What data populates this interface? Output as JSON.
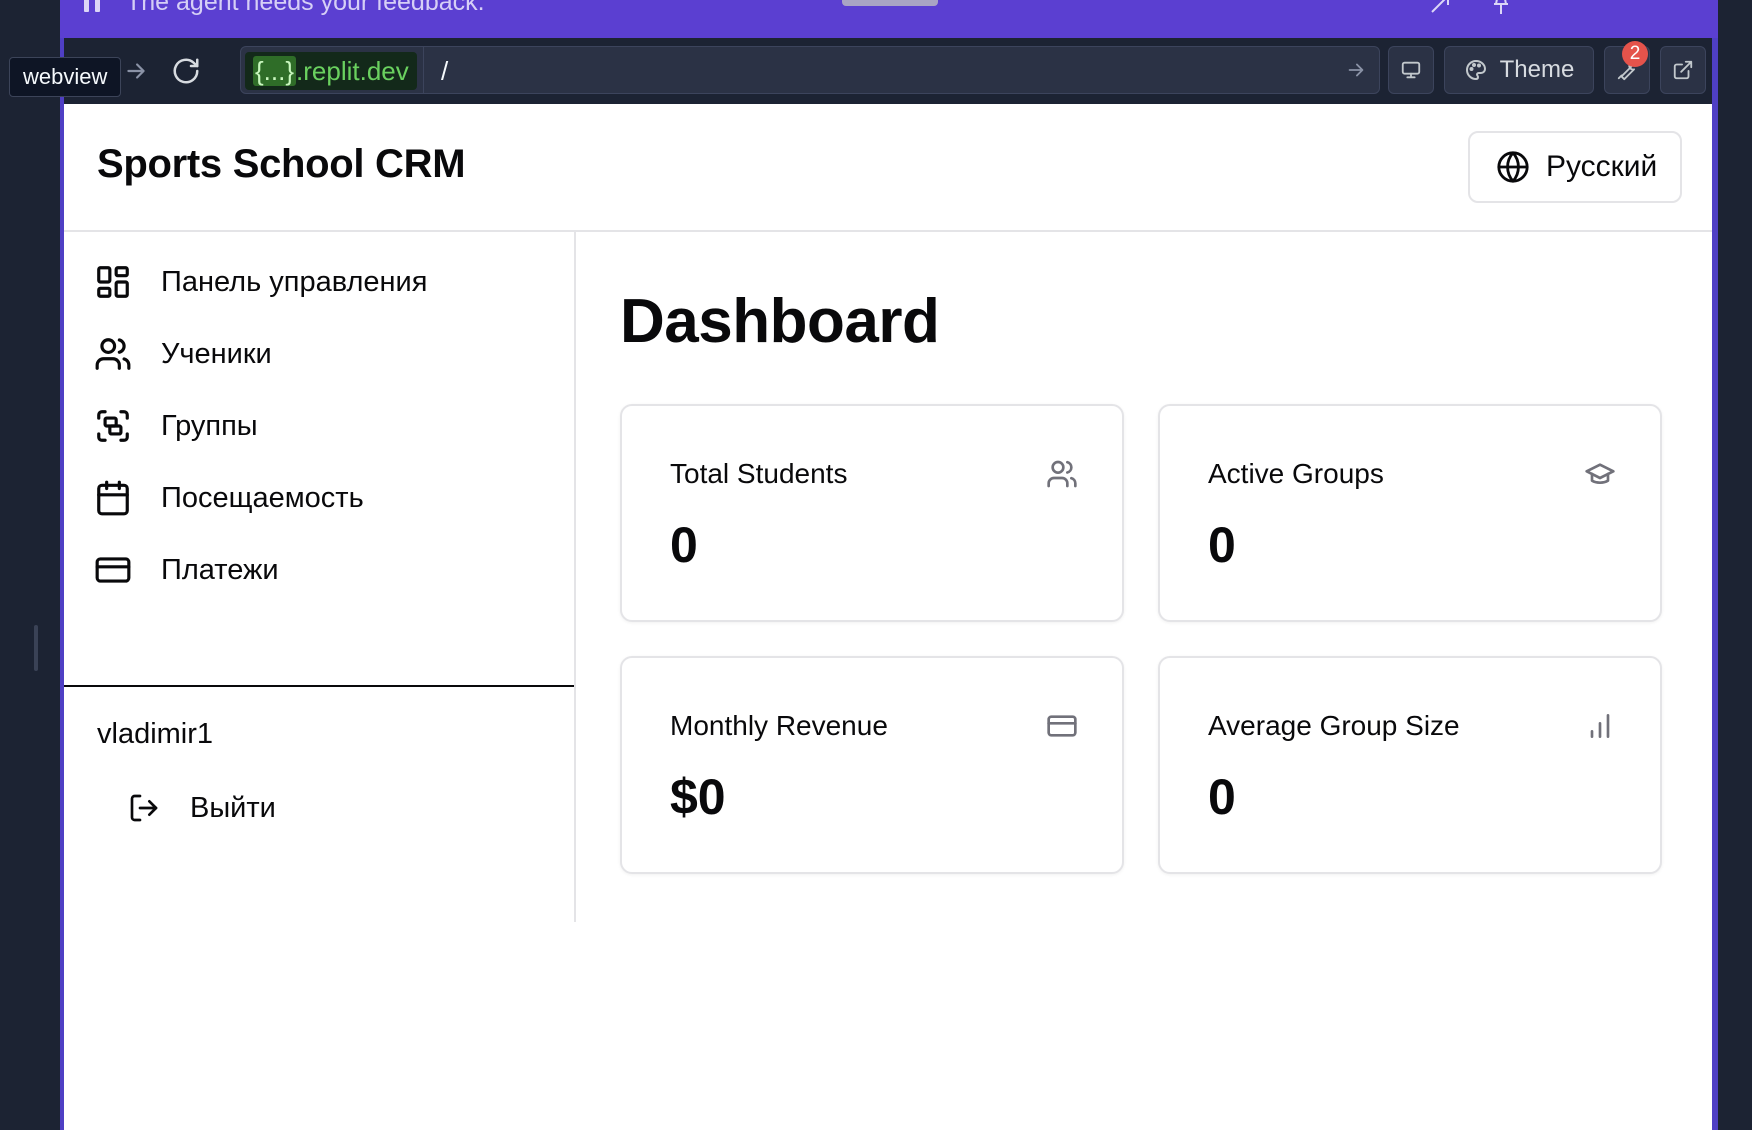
{
  "agent_banner": {
    "text": "The agent needs your feedback."
  },
  "browser": {
    "tooltip": "webview",
    "url_domain_template": "{...}",
    "url_domain_rest": ".replit.dev",
    "url_path": "/",
    "theme_label": "Theme",
    "notification_count": "2"
  },
  "app": {
    "title": "Sports School CRM",
    "language_label": "Русский"
  },
  "sidebar": {
    "items": [
      {
        "label": "Панель управления",
        "icon": "layout-dashboard-icon"
      },
      {
        "label": "Ученики",
        "icon": "users-icon"
      },
      {
        "label": "Группы",
        "icon": "group-icon"
      },
      {
        "label": "Посещаемость",
        "icon": "calendar-icon"
      },
      {
        "label": "Платежи",
        "icon": "credit-card-icon"
      }
    ],
    "username": "vladimir1",
    "logout_label": "Выйти"
  },
  "main": {
    "title": "Dashboard",
    "cards": [
      {
        "label": "Total Students",
        "value": "0",
        "icon": "users-icon"
      },
      {
        "label": "Active Groups",
        "value": "0",
        "icon": "graduation-cap-icon"
      },
      {
        "label": "Monthly Revenue",
        "value": "$0",
        "icon": "credit-card-icon"
      },
      {
        "label": "Average Group Size",
        "value": "0",
        "icon": "bar-chart-icon"
      }
    ]
  },
  "colors": {
    "agent_banner": "#5b3fd1",
    "ide_background": "#1c2333",
    "url_domain_green": "#6ad15f",
    "badge_red": "#e5534b",
    "text_primary": "#09090b",
    "muted_icon": "#71717a",
    "border": "#e4e4e7"
  }
}
